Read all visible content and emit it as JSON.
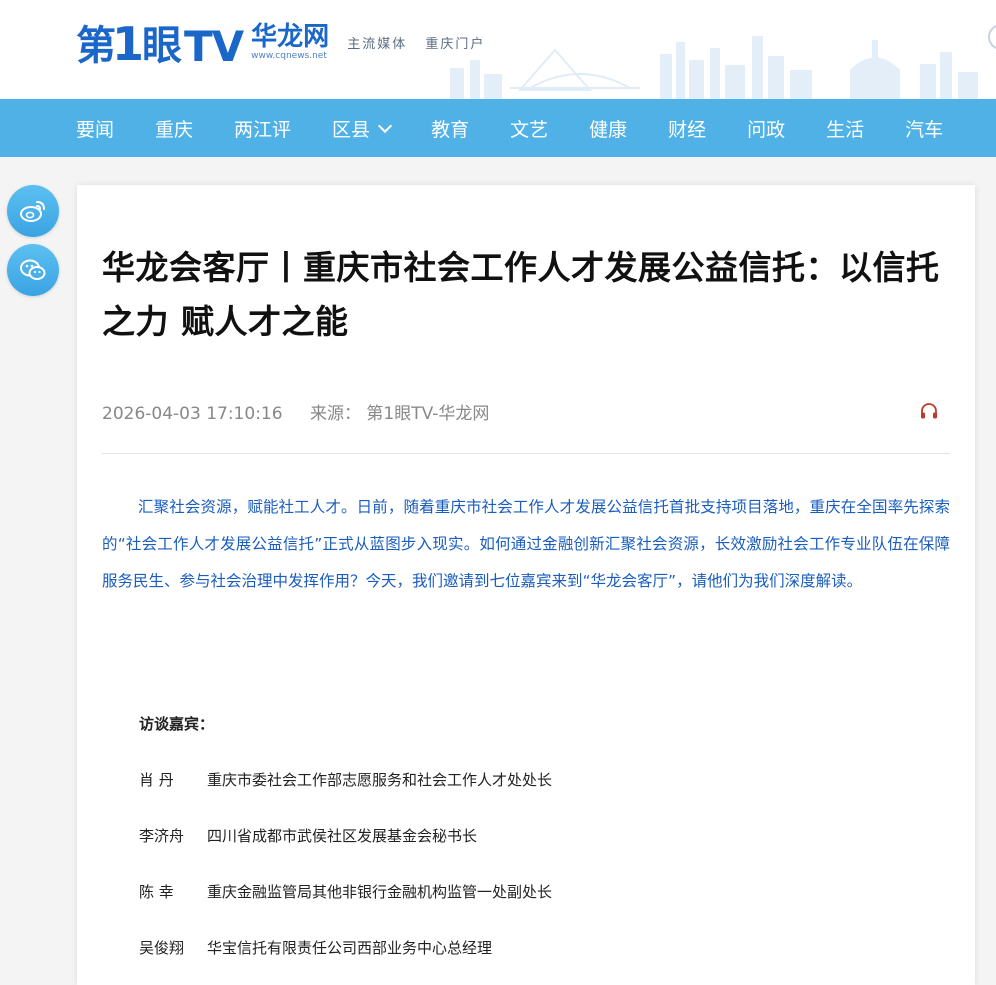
{
  "brand": {
    "logo_di": "第",
    "logo_one": "1",
    "logo_yan": "眼",
    "logo_tv": "TV",
    "site_name": "华龙网",
    "site_url": "www.cqnews.net",
    "slogan_left": "主流媒体",
    "slogan_right": "重庆门户",
    "brand_color": "#1a66c9"
  },
  "nav": {
    "background": "#4fb1e6",
    "items": [
      {
        "label": "要闻"
      },
      {
        "label": "重庆"
      },
      {
        "label": "两江评"
      },
      {
        "label": "区县",
        "has_dropdown": true
      },
      {
        "label": "教育"
      },
      {
        "label": "文艺"
      },
      {
        "label": "健康"
      },
      {
        "label": "财经"
      },
      {
        "label": "问政"
      },
      {
        "label": "生活"
      },
      {
        "label": "汽车"
      }
    ]
  },
  "share": {
    "weibo_icon": "weibo-icon",
    "wechat_icon": "wechat-icon"
  },
  "article": {
    "title": "华龙会客厅丨重庆市社会工作人才发展公益信托：以信托之力 赋人才之能",
    "datetime": "2026-04-03 17:10:16",
    "source_label": "来源：",
    "source": "第1眼TV-华龙网",
    "audio_icon": "headphones-icon",
    "lead": "汇聚社会资源，赋能社工人才。日前，随着重庆市社会工作人才发展公益信托首批支持项目落地，重庆在全国率先探索的“社会工作人才发展公益信托”正式从蓝图步入现实。如何通过金融创新汇聚社会资源，长效激励社会工作专业队伍在保障服务民生、参与社会治理中发挥作用？今天，我们邀请到七位嘉宾来到“华龙会客厅”，请他们为我们深度解读。",
    "lead_color": "#1a5dbf",
    "guests_heading": "访谈嘉宾：",
    "guests": [
      {
        "name": "肖 丹",
        "title": "重庆市委社会工作部志愿服务和社会工作人才处处长"
      },
      {
        "name": "李济舟",
        "title": "四川省成都市武侯社区发展基金会秘书长"
      },
      {
        "name": "陈 幸",
        "title": "重庆金融监管局其他非银行金融机构监管一处副处长"
      },
      {
        "name": "吴俊翔",
        "title": "华宝信托有限责任公司西部业务中心总经理"
      }
    ]
  }
}
